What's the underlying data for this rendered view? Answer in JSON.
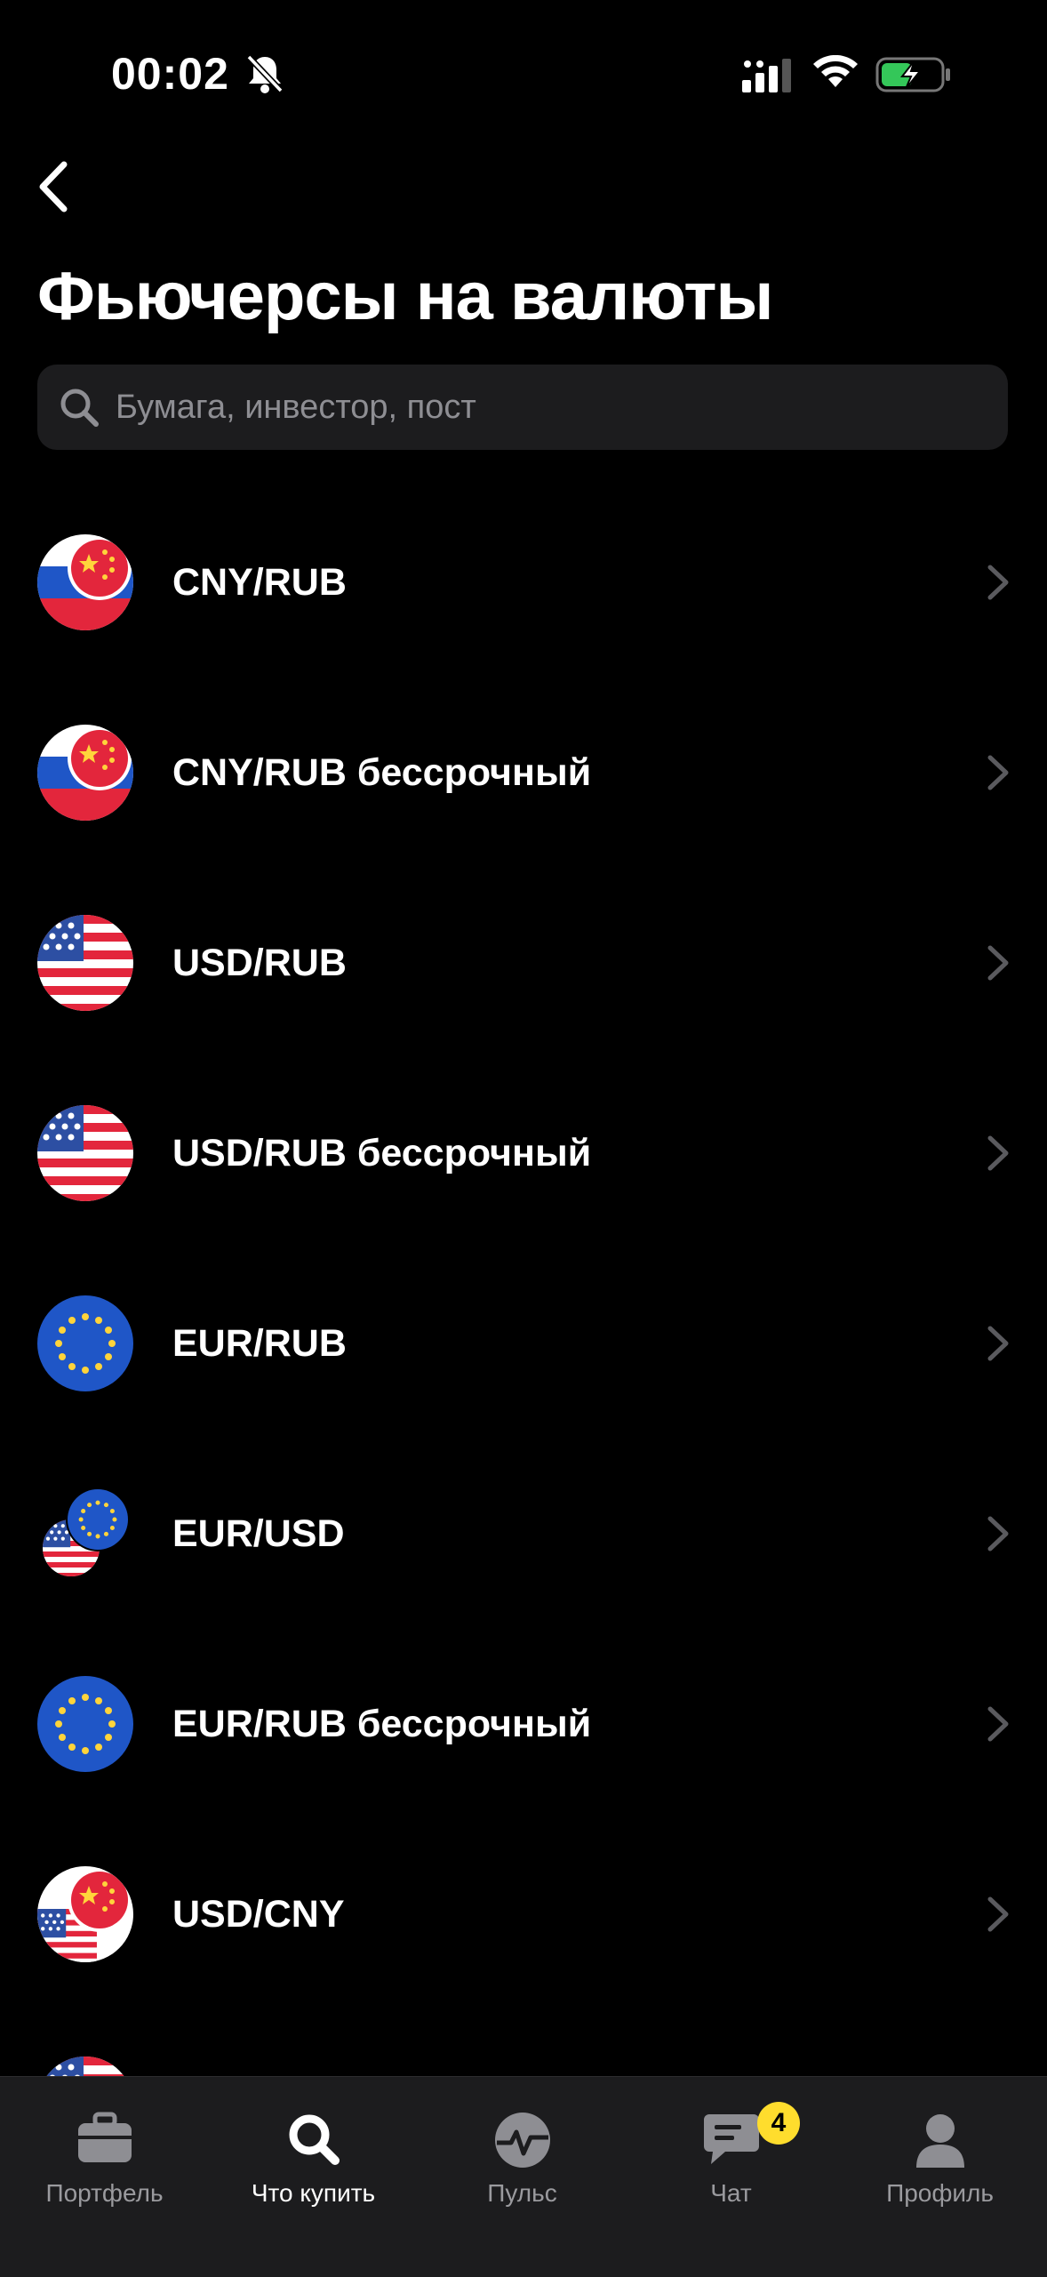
{
  "status_bar": {
    "time": "00:02"
  },
  "header": {
    "title": "Фьючерсы на валюты"
  },
  "search": {
    "placeholder": "Бумага, инвестор, пост"
  },
  "items": [
    {
      "label": "CNY/RUB",
      "flag": "cny-rub-flag-icon"
    },
    {
      "label": "CNY/RUB бессрочный",
      "flag": "cny-rub-flag-icon"
    },
    {
      "label": "USD/RUB",
      "flag": "usa-flag-icon"
    },
    {
      "label": "USD/RUB бессрочный",
      "flag": "usa-flag-icon"
    },
    {
      "label": "EUR/RUB",
      "flag": "eu-flag-icon"
    },
    {
      "label": "EUR/USD",
      "flag": "eur-usd-flag-icon"
    },
    {
      "label": "EUR/RUB бессрочный",
      "flag": "eu-flag-icon"
    },
    {
      "label": "USD/CNY",
      "flag": "usd-cny-flag-icon"
    }
  ],
  "tabbar": {
    "tabs": [
      {
        "label": "Портфель",
        "icon": "briefcase-icon"
      },
      {
        "label": "Что купить",
        "icon": "search-icon",
        "active": true
      },
      {
        "label": "Пульс",
        "icon": "pulse-icon"
      },
      {
        "label": "Чат",
        "icon": "chat-icon",
        "badge": "4"
      },
      {
        "label": "Профиль",
        "icon": "profile-icon"
      }
    ]
  },
  "colors": {
    "background": "#000000",
    "surface": "#1c1c1e",
    "accent": "#ffdd2d",
    "muted": "#8e8e93"
  }
}
